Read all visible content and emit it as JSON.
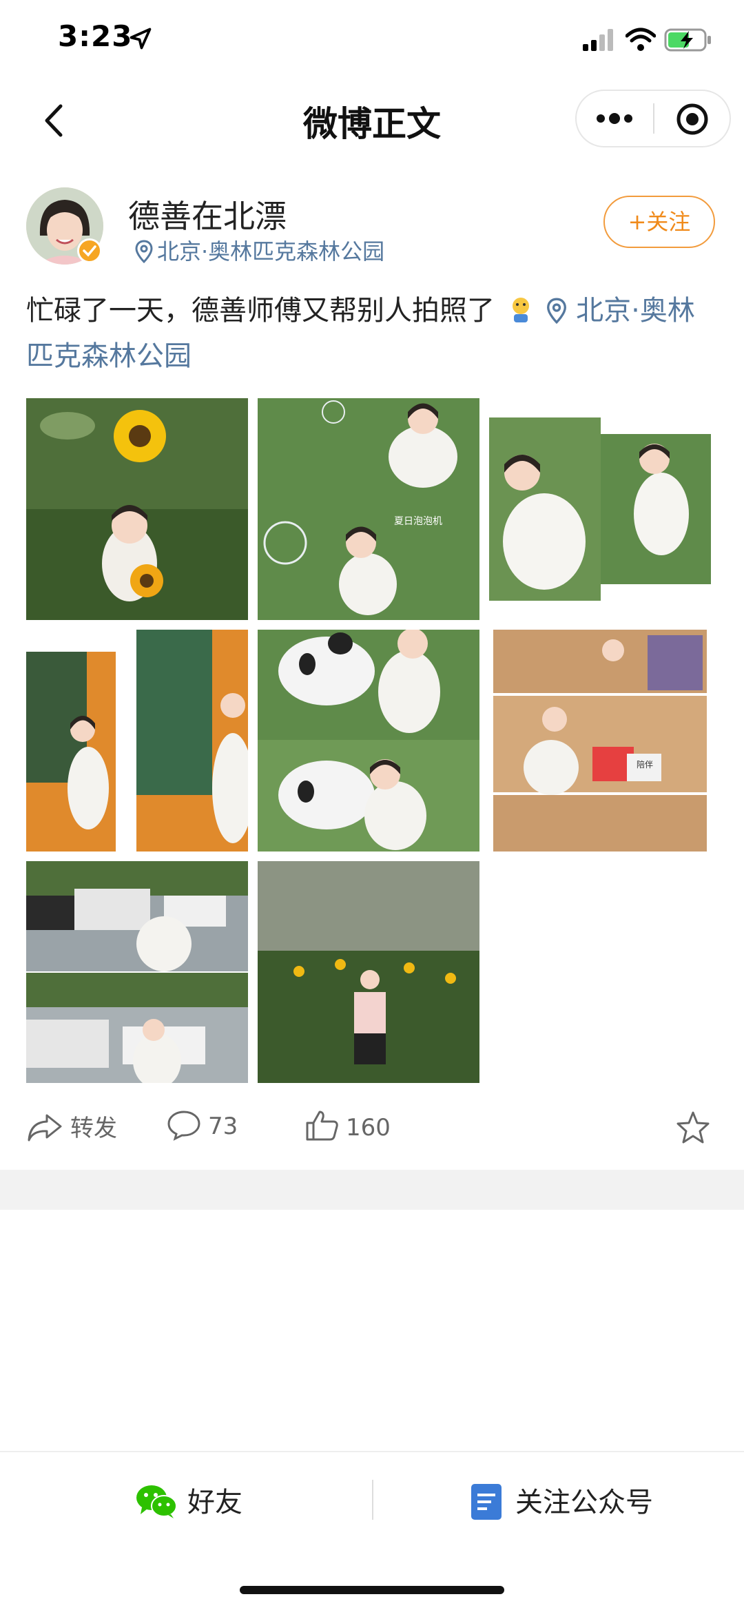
{
  "status": {
    "time": "3:23"
  },
  "nav": {
    "title": "微博正文"
  },
  "post": {
    "username": "德善在北漂",
    "location": "北京·奥林匹克森林公园",
    "follow_label": "+关注",
    "text": "忙碌了一天，德善师傅又帮别人拍照了",
    "location_link_line1": "北京·奥林",
    "location_link_line2": "匹克森林公园"
  },
  "images": [
    {
      "name": "sunflower-photo"
    },
    {
      "name": "bubbles-photo",
      "caption": "夏日泡泡机"
    },
    {
      "name": "white-dress-photo"
    },
    {
      "name": "vending-machine-photo"
    },
    {
      "name": "panda-photo"
    },
    {
      "name": "bookstore-photo",
      "caption": "陪伴"
    },
    {
      "name": "parking-lot-photo"
    },
    {
      "name": "sunflower-field-photo"
    }
  ],
  "actions": {
    "repost_label": "转发",
    "comment_count": "73",
    "like_count": "160"
  },
  "bottom": {
    "friends_label": "好友",
    "follow_account_label": "关注公众号"
  },
  "colors": {
    "link": "#55789e",
    "accent": "#f08a1a",
    "wechat_green": "#2dc100",
    "doc_blue": "#3b7bd7"
  }
}
